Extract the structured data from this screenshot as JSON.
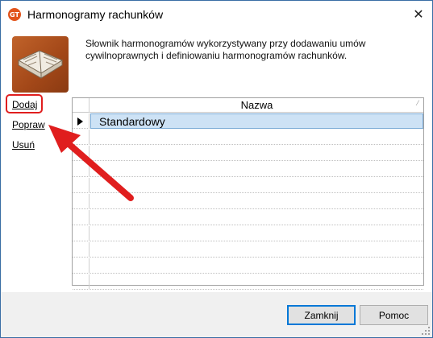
{
  "window": {
    "title": "Harmonogramy rachunków",
    "app_icon_text": "GT",
    "close_glyph": "✕"
  },
  "description": "Słownik harmonogramów wykorzystywany przy dodawaniu umów cywilnoprawnych i definiowaniu harmonogramów rachunków.",
  "actions": {
    "add_label": "Dodaj",
    "edit_label": "Popraw",
    "delete_label": "Usuń"
  },
  "grid": {
    "column_header": "Nazwa",
    "sort_indicator": "⁄",
    "rows": [
      {
        "name": "Standardowy",
        "selected": true
      },
      {
        "name": ""
      },
      {
        "name": ""
      },
      {
        "name": ""
      },
      {
        "name": ""
      },
      {
        "name": ""
      },
      {
        "name": ""
      },
      {
        "name": ""
      },
      {
        "name": ""
      },
      {
        "name": ""
      },
      {
        "name": ""
      }
    ]
  },
  "footer": {
    "close_label": "Zamknij",
    "help_label": "Pomoc"
  },
  "colors": {
    "highlight": "#e01e1e",
    "selection": "#cde2f5",
    "app_icon": "#e2541b"
  },
  "icons": {
    "hero": "book-icon",
    "annotation": "red-arrow-icon"
  }
}
